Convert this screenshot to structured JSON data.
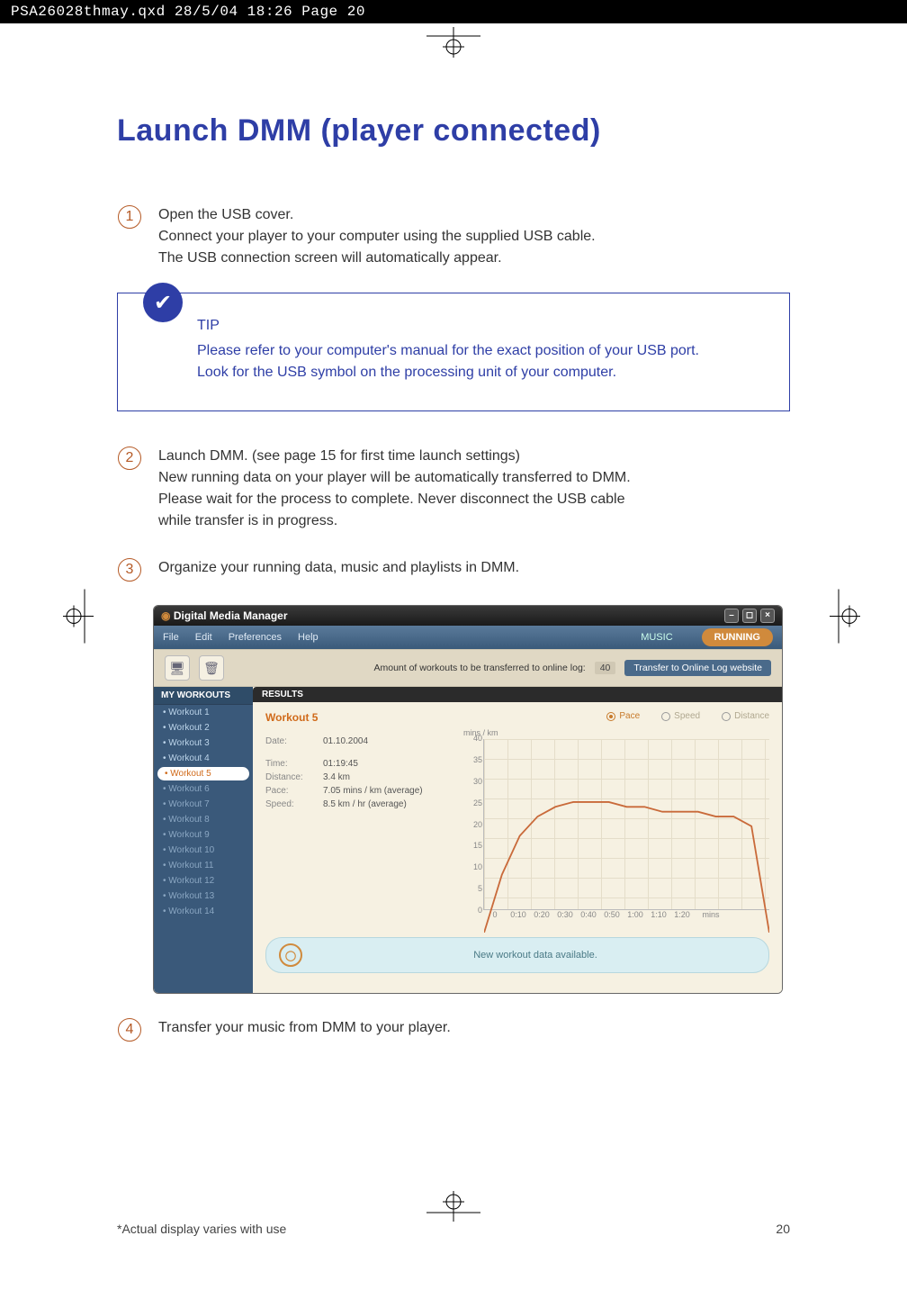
{
  "print_header": "PSA26028thmay.qxd  28/5/04  18:26  Page 20",
  "title": "Launch DMM (player connected)",
  "steps": {
    "s1": "Open the USB cover.\nConnect your player to your computer using the supplied USB cable.\nThe USB connection screen will automatically appear.",
    "s2": "Launch DMM.  (see page 15 for first time launch settings)\nNew running data on your player will be automatically transferred to DMM.\nPlease wait for the process to complete.  Never disconnect the USB cable\nwhile  transfer is in progress.",
    "s3": "Organize your running data, music and playlists in DMM.",
    "s4": "Transfer your music from DMM to your player."
  },
  "tip": {
    "label": "TIP",
    "body": "Please refer to your computer's manual for the exact position of your USB port.\nLook for the USB symbol on the processing unit of your computer."
  },
  "dmm": {
    "title": "Digital Media Manager",
    "menus": {
      "file": "File",
      "edit": "Edit",
      "preferences": "Preferences",
      "help": "Help"
    },
    "tabs": {
      "music": "MUSIC",
      "running": "RUNNING"
    },
    "subbar": {
      "transfer_label": "Amount of workouts to be transferred to online log:",
      "transfer_count": "40",
      "transfer_btn": "Transfer to Online Log website"
    },
    "sidebar": {
      "header": "MY WORKOUTS",
      "items": [
        "Workout 1",
        "Workout 2",
        "Workout 3",
        "Workout 4",
        "Workout 5",
        "Workout 6",
        "Workout 7",
        "Workout 8",
        "Workout 9",
        "Workout 10",
        "Workout 11",
        "Workout 12",
        "Workout 13",
        "Workout 14"
      ],
      "selected_index": 4
    },
    "results": {
      "header": "RESULTS",
      "workout_name": "Workout 5",
      "rows": {
        "date": {
          "lab": "Date:",
          "val": "01.10.2004"
        },
        "time": {
          "lab": "Time:",
          "val": "01:19:45"
        },
        "distance": {
          "lab": "Distance:",
          "val": "3.4 km"
        },
        "pace": {
          "lab": "Pace:",
          "val": "7.05 mins / km (average)"
        },
        "speed": {
          "lab": "Speed:",
          "val": "8.5 km / hr (average)"
        }
      },
      "radios": {
        "pace": "Pace",
        "speed": "Speed",
        "distance": "Distance"
      },
      "ylabel": "mins / km",
      "xunit": "mins"
    },
    "status": "New workout data available."
  },
  "footer": {
    "note": "*Actual display varies with use",
    "page": "20"
  },
  "chart_data": {
    "type": "line",
    "title": "",
    "xlabel": "mins",
    "ylabel": "mins / km",
    "ylim": [
      0,
      40
    ],
    "yticks": [
      40,
      35,
      30,
      25,
      20,
      15,
      10,
      5,
      0
    ],
    "xticks": [
      "0",
      "0:10",
      "0:20",
      "0:30",
      "0:40",
      "0:50",
      "1:00",
      "1:10",
      "1:20"
    ],
    "series": [
      {
        "name": "Pace",
        "color": "#c96a3a",
        "x": [
          "0:00",
          "0:05",
          "0:10",
          "0:15",
          "0:20",
          "0:25",
          "0:30",
          "0:35",
          "0:40",
          "0:45",
          "0:50",
          "0:55",
          "1:00",
          "1:05",
          "1:10",
          "1:15",
          "1:20"
        ],
        "values": [
          0,
          12,
          20,
          24,
          26,
          27,
          27,
          27,
          26,
          26,
          25,
          25,
          25,
          24,
          24,
          22,
          0
        ]
      }
    ]
  }
}
